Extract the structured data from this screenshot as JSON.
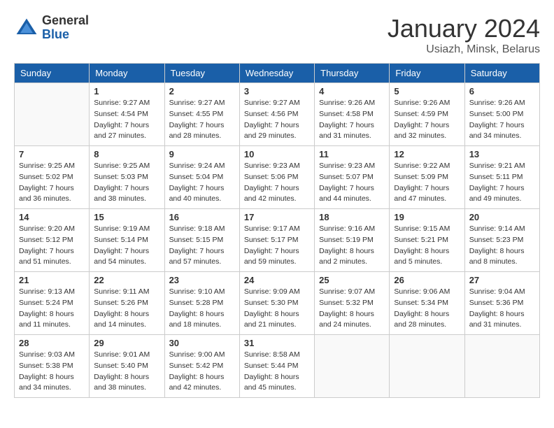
{
  "header": {
    "logo_general": "General",
    "logo_blue": "Blue",
    "month_title": "January 2024",
    "location": "Usiazh, Minsk, Belarus"
  },
  "days_of_week": [
    "Sunday",
    "Monday",
    "Tuesday",
    "Wednesday",
    "Thursday",
    "Friday",
    "Saturday"
  ],
  "weeks": [
    [
      {
        "day": "",
        "sunrise": "",
        "sunset": "",
        "daylight": ""
      },
      {
        "day": "1",
        "sunrise": "Sunrise: 9:27 AM",
        "sunset": "Sunset: 4:54 PM",
        "daylight": "Daylight: 7 hours and 27 minutes."
      },
      {
        "day": "2",
        "sunrise": "Sunrise: 9:27 AM",
        "sunset": "Sunset: 4:55 PM",
        "daylight": "Daylight: 7 hours and 28 minutes."
      },
      {
        "day": "3",
        "sunrise": "Sunrise: 9:27 AM",
        "sunset": "Sunset: 4:56 PM",
        "daylight": "Daylight: 7 hours and 29 minutes."
      },
      {
        "day": "4",
        "sunrise": "Sunrise: 9:26 AM",
        "sunset": "Sunset: 4:58 PM",
        "daylight": "Daylight: 7 hours and 31 minutes."
      },
      {
        "day": "5",
        "sunrise": "Sunrise: 9:26 AM",
        "sunset": "Sunset: 4:59 PM",
        "daylight": "Daylight: 7 hours and 32 minutes."
      },
      {
        "day": "6",
        "sunrise": "Sunrise: 9:26 AM",
        "sunset": "Sunset: 5:00 PM",
        "daylight": "Daylight: 7 hours and 34 minutes."
      }
    ],
    [
      {
        "day": "7",
        "sunrise": "Sunrise: 9:25 AM",
        "sunset": "Sunset: 5:02 PM",
        "daylight": "Daylight: 7 hours and 36 minutes."
      },
      {
        "day": "8",
        "sunrise": "Sunrise: 9:25 AM",
        "sunset": "Sunset: 5:03 PM",
        "daylight": "Daylight: 7 hours and 38 minutes."
      },
      {
        "day": "9",
        "sunrise": "Sunrise: 9:24 AM",
        "sunset": "Sunset: 5:04 PM",
        "daylight": "Daylight: 7 hours and 40 minutes."
      },
      {
        "day": "10",
        "sunrise": "Sunrise: 9:23 AM",
        "sunset": "Sunset: 5:06 PM",
        "daylight": "Daylight: 7 hours and 42 minutes."
      },
      {
        "day": "11",
        "sunrise": "Sunrise: 9:23 AM",
        "sunset": "Sunset: 5:07 PM",
        "daylight": "Daylight: 7 hours and 44 minutes."
      },
      {
        "day": "12",
        "sunrise": "Sunrise: 9:22 AM",
        "sunset": "Sunset: 5:09 PM",
        "daylight": "Daylight: 7 hours and 47 minutes."
      },
      {
        "day": "13",
        "sunrise": "Sunrise: 9:21 AM",
        "sunset": "Sunset: 5:11 PM",
        "daylight": "Daylight: 7 hours and 49 minutes."
      }
    ],
    [
      {
        "day": "14",
        "sunrise": "Sunrise: 9:20 AM",
        "sunset": "Sunset: 5:12 PM",
        "daylight": "Daylight: 7 hours and 51 minutes."
      },
      {
        "day": "15",
        "sunrise": "Sunrise: 9:19 AM",
        "sunset": "Sunset: 5:14 PM",
        "daylight": "Daylight: 7 hours and 54 minutes."
      },
      {
        "day": "16",
        "sunrise": "Sunrise: 9:18 AM",
        "sunset": "Sunset: 5:15 PM",
        "daylight": "Daylight: 7 hours and 57 minutes."
      },
      {
        "day": "17",
        "sunrise": "Sunrise: 9:17 AM",
        "sunset": "Sunset: 5:17 PM",
        "daylight": "Daylight: 7 hours and 59 minutes."
      },
      {
        "day": "18",
        "sunrise": "Sunrise: 9:16 AM",
        "sunset": "Sunset: 5:19 PM",
        "daylight": "Daylight: 8 hours and 2 minutes."
      },
      {
        "day": "19",
        "sunrise": "Sunrise: 9:15 AM",
        "sunset": "Sunset: 5:21 PM",
        "daylight": "Daylight: 8 hours and 5 minutes."
      },
      {
        "day": "20",
        "sunrise": "Sunrise: 9:14 AM",
        "sunset": "Sunset: 5:23 PM",
        "daylight": "Daylight: 8 hours and 8 minutes."
      }
    ],
    [
      {
        "day": "21",
        "sunrise": "Sunrise: 9:13 AM",
        "sunset": "Sunset: 5:24 PM",
        "daylight": "Daylight: 8 hours and 11 minutes."
      },
      {
        "day": "22",
        "sunrise": "Sunrise: 9:11 AM",
        "sunset": "Sunset: 5:26 PM",
        "daylight": "Daylight: 8 hours and 14 minutes."
      },
      {
        "day": "23",
        "sunrise": "Sunrise: 9:10 AM",
        "sunset": "Sunset: 5:28 PM",
        "daylight": "Daylight: 8 hours and 18 minutes."
      },
      {
        "day": "24",
        "sunrise": "Sunrise: 9:09 AM",
        "sunset": "Sunset: 5:30 PM",
        "daylight": "Daylight: 8 hours and 21 minutes."
      },
      {
        "day": "25",
        "sunrise": "Sunrise: 9:07 AM",
        "sunset": "Sunset: 5:32 PM",
        "daylight": "Daylight: 8 hours and 24 minutes."
      },
      {
        "day": "26",
        "sunrise": "Sunrise: 9:06 AM",
        "sunset": "Sunset: 5:34 PM",
        "daylight": "Daylight: 8 hours and 28 minutes."
      },
      {
        "day": "27",
        "sunrise": "Sunrise: 9:04 AM",
        "sunset": "Sunset: 5:36 PM",
        "daylight": "Daylight: 8 hours and 31 minutes."
      }
    ],
    [
      {
        "day": "28",
        "sunrise": "Sunrise: 9:03 AM",
        "sunset": "Sunset: 5:38 PM",
        "daylight": "Daylight: 8 hours and 34 minutes."
      },
      {
        "day": "29",
        "sunrise": "Sunrise: 9:01 AM",
        "sunset": "Sunset: 5:40 PM",
        "daylight": "Daylight: 8 hours and 38 minutes."
      },
      {
        "day": "30",
        "sunrise": "Sunrise: 9:00 AM",
        "sunset": "Sunset: 5:42 PM",
        "daylight": "Daylight: 8 hours and 42 minutes."
      },
      {
        "day": "31",
        "sunrise": "Sunrise: 8:58 AM",
        "sunset": "Sunset: 5:44 PM",
        "daylight": "Daylight: 8 hours and 45 minutes."
      },
      {
        "day": "",
        "sunrise": "",
        "sunset": "",
        "daylight": ""
      },
      {
        "day": "",
        "sunrise": "",
        "sunset": "",
        "daylight": ""
      },
      {
        "day": "",
        "sunrise": "",
        "sunset": "",
        "daylight": ""
      }
    ]
  ]
}
